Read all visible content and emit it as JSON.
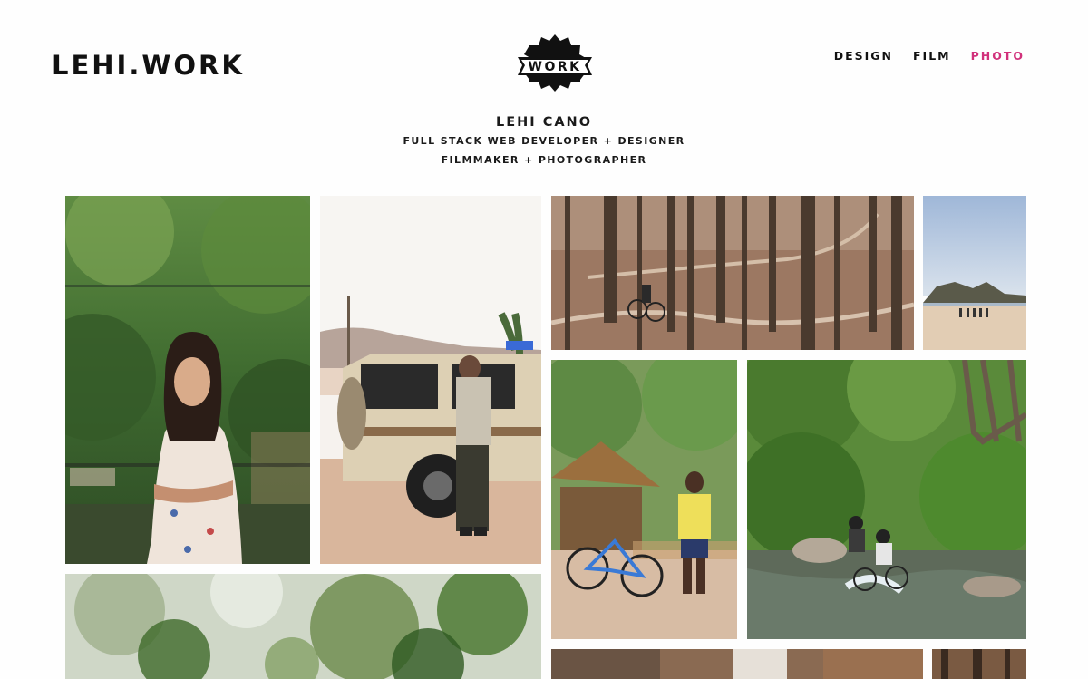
{
  "header": {
    "site_title": "LEHI.WORK",
    "badge_text": "WORK",
    "nav": [
      {
        "label": "DESIGN",
        "active": false
      },
      {
        "label": "FILM",
        "active": false
      },
      {
        "label": "PHOTO",
        "active": true
      }
    ]
  },
  "intro": {
    "name": "LEHI CANO",
    "line1": "FULL STACK WEB DEVELOPER + DESIGNER",
    "line2": "FILMMAKER + PHOTOGRAPHER"
  },
  "colors": {
    "text": "#111111",
    "accent": "#d1317b",
    "background": "#ffffff"
  },
  "gallery": [
    {
      "name": "photo-woman-garden-portrait"
    },
    {
      "name": "photo-man-leaning-on-suv"
    },
    {
      "name": "photo-cyclist-forest-trail"
    },
    {
      "name": "photo-beach-hills"
    },
    {
      "name": "photo-man-with-bicycle-hut"
    },
    {
      "name": "photo-cyclists-crossing-stream"
    },
    {
      "name": "photo-leaves-closeup"
    },
    {
      "name": "photo-autumn-forest-strip"
    },
    {
      "name": "photo-forest-strip-right"
    }
  ]
}
